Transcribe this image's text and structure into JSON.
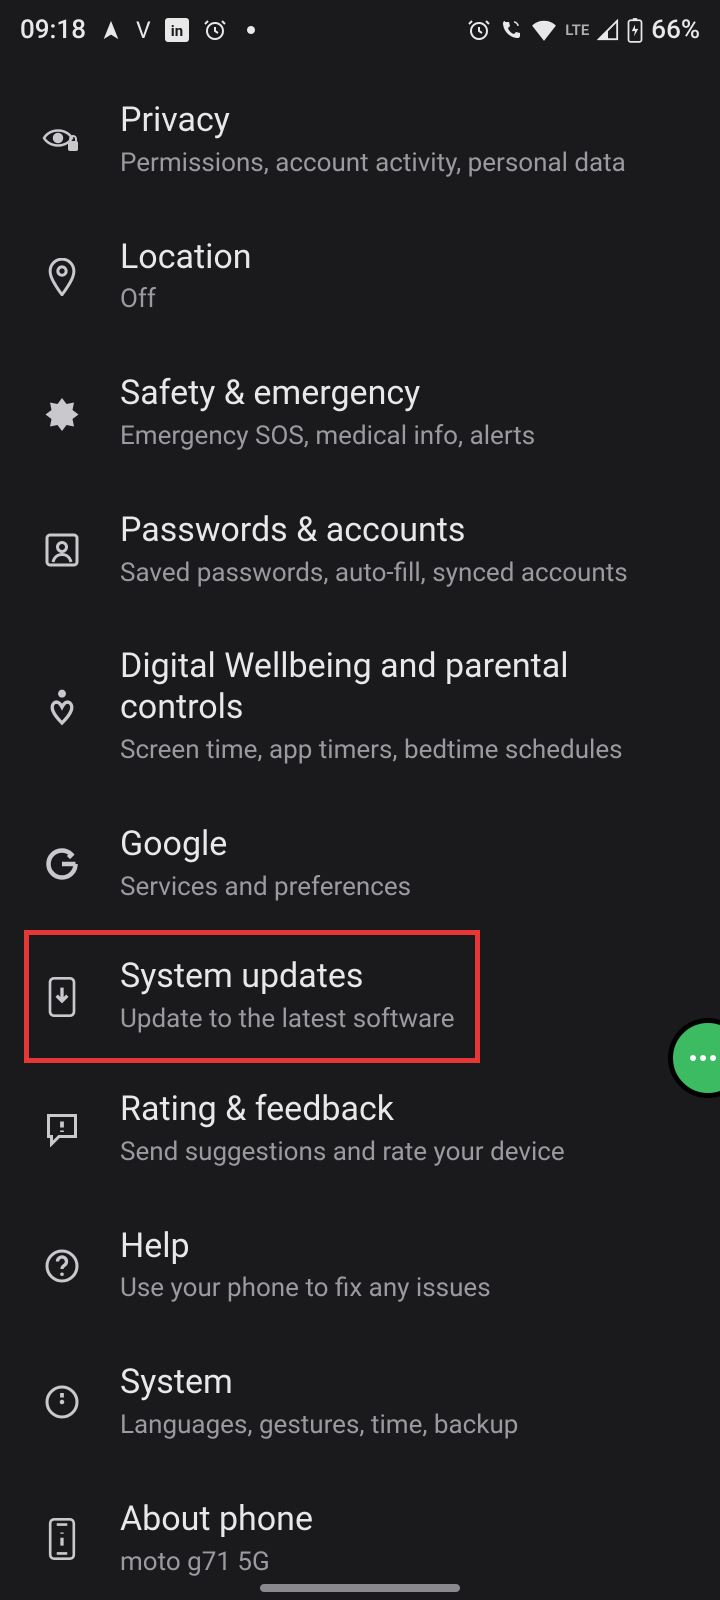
{
  "status": {
    "time": "09:18",
    "lte": "LTE",
    "battery": "66%"
  },
  "settings": [
    {
      "id": "privacy",
      "title": "Privacy",
      "subtitle": "Permissions, account activity, personal data"
    },
    {
      "id": "location",
      "title": "Location",
      "subtitle": "Off"
    },
    {
      "id": "safety",
      "title": "Safety & emergency",
      "subtitle": "Emergency SOS, medical info, alerts"
    },
    {
      "id": "passwords",
      "title": "Passwords & accounts",
      "subtitle": "Saved passwords, auto-fill, synced accounts"
    },
    {
      "id": "wellbeing",
      "title": "Digital Wellbeing and parental controls",
      "subtitle": "Screen time, app timers, bedtime schedules"
    },
    {
      "id": "google",
      "title": "Google",
      "subtitle": "Services and preferences"
    },
    {
      "id": "updates",
      "title": "System updates",
      "subtitle": "Update to the latest software"
    },
    {
      "id": "rating",
      "title": "Rating & feedback",
      "subtitle": "Send suggestions and rate your device"
    },
    {
      "id": "help",
      "title": "Help",
      "subtitle": "Use your phone to fix any issues"
    },
    {
      "id": "system",
      "title": "System",
      "subtitle": "Languages, gestures, time, backup"
    },
    {
      "id": "about",
      "title": "About phone",
      "subtitle": "moto g71 5G"
    }
  ],
  "highlight_index": 6
}
